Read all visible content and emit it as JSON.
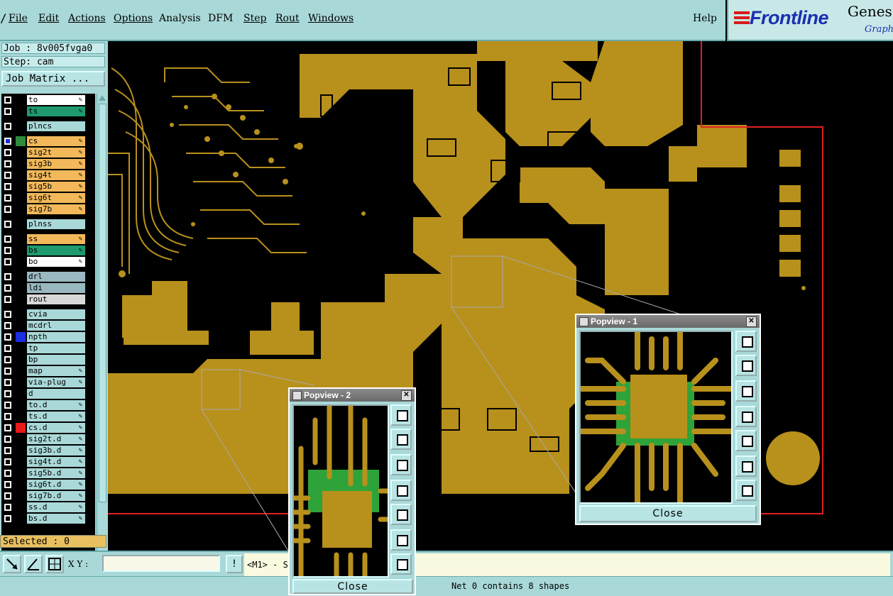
{
  "menu": {
    "items": [
      "File",
      "Edit",
      "Actions",
      "Options",
      "Analysis",
      "DFM",
      "Step",
      "Rout",
      "Windows"
    ],
    "help": "Help"
  },
  "logo": {
    "brand": "Frontline",
    "product": "Genes",
    "sub": "Graphi"
  },
  "job": {
    "job_line": "Job : 8v005fvga0",
    "step_line": "Step: cam",
    "matrix_button": "Job Matrix ..."
  },
  "layers": [
    {
      "name": "to",
      "color": "#ffffff",
      "edit": true
    },
    {
      "name": "ts",
      "color": "#1e9a6e",
      "edit": true
    },
    {
      "name": "plncs",
      "color": "#a9d8d8",
      "edit": false
    },
    {
      "name": "cs",
      "color": "#f2b85a",
      "edit": true,
      "selected": true,
      "swatch": "#2e8b3a"
    },
    {
      "name": "sig2t",
      "color": "#f2b85a",
      "edit": true
    },
    {
      "name": "sig3b",
      "color": "#f2b85a",
      "edit": true
    },
    {
      "name": "sig4t",
      "color": "#f2b85a",
      "edit": true
    },
    {
      "name": "sig5b",
      "color": "#f2b85a",
      "edit": true
    },
    {
      "name": "sig6t",
      "color": "#f2b85a",
      "edit": true
    },
    {
      "name": "sig7b",
      "color": "#f2b85a",
      "edit": true
    },
    {
      "name": "plnss",
      "color": "#a9d8d8",
      "edit": false
    },
    {
      "name": "ss",
      "color": "#f2b85a",
      "edit": true
    },
    {
      "name": "bs",
      "color": "#1e9a6e",
      "edit": true
    },
    {
      "name": "bo",
      "color": "#ffffff",
      "edit": true
    },
    {
      "name": "drl",
      "color": "#9ab8c0",
      "edit": false
    },
    {
      "name": "ldi",
      "color": "#9ab8c0",
      "edit": false
    },
    {
      "name": "rout",
      "color": "#d8d8d8",
      "edit": false
    },
    {
      "name": "cvia",
      "color": "#a9d8d8",
      "edit": false
    },
    {
      "name": "mcdrl",
      "color": "#a9d8d8",
      "edit": false
    },
    {
      "name": "npth",
      "color": "#a9d8d8",
      "edit": false,
      "swatch": "#1a2fe0"
    },
    {
      "name": "tp",
      "color": "#a9d8d8",
      "edit": false
    },
    {
      "name": "bp",
      "color": "#a9d8d8",
      "edit": false
    },
    {
      "name": "map",
      "color": "#a9d8d8",
      "edit": true
    },
    {
      "name": "via-plug",
      "color": "#a9d8d8",
      "edit": true
    },
    {
      "name": "d",
      "color": "#a9d8d8",
      "edit": false
    },
    {
      "name": "to.d",
      "color": "#a9d8d8",
      "edit": true
    },
    {
      "name": "ts.d",
      "color": "#a9d8d8",
      "edit": true
    },
    {
      "name": "cs.d",
      "color": "#a9d8d8",
      "edit": true,
      "swatch": "#e81a1a"
    },
    {
      "name": "sig2t.d",
      "color": "#a9d8d8",
      "edit": true
    },
    {
      "name": "sig3b.d",
      "color": "#a9d8d8",
      "edit": true
    },
    {
      "name": "sig4t.d",
      "color": "#a9d8d8",
      "edit": true
    },
    {
      "name": "sig5b.d",
      "color": "#a9d8d8",
      "edit": true
    },
    {
      "name": "sig6t.d",
      "color": "#a9d8d8",
      "edit": true
    },
    {
      "name": "sig7b.d",
      "color": "#a9d8d8",
      "edit": true
    },
    {
      "name": "ss.d",
      "color": "#a9d8d8",
      "edit": true
    },
    {
      "name": "bs.d",
      "color": "#a9d8d8",
      "edit": true
    }
  ],
  "selected_text": "Selected : 0",
  "bottom": {
    "xy_label": "X Y :",
    "message": "<M1> - S",
    "xy_value": ""
  },
  "status": "Net 0 contains 8 shapes",
  "popview1": {
    "title": "Popview - 1",
    "close": "Close"
  },
  "popview2": {
    "title": "Popview - 2",
    "close": "Close"
  },
  "colors": {
    "copper": "#b8901c",
    "panel": "#a9d8d8",
    "outline": "#e02020"
  }
}
